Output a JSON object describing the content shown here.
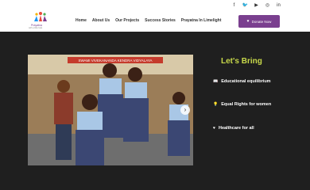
{
  "header": {
    "logo_name": "Prayatna",
    "logo_tagline": "with a little help",
    "social": [
      "facebook-icon",
      "twitter-icon",
      "youtube-icon",
      "instagram-icon",
      "linkedin-icon"
    ],
    "nav": [
      "Home",
      "About Us",
      "Our Projects",
      "Success Stories",
      "Prayatna In Limelight"
    ],
    "donate_label": "Donate Now"
  },
  "hero": {
    "school_sign": "SWAMI VIVEKANANDA KENDRA VIDYALAYA"
  },
  "mission": {
    "heading": "Let's Bring",
    "items": [
      {
        "icon": "book-icon",
        "label": "Educational equilibrium"
      },
      {
        "icon": "bulb-icon",
        "label": "Equal Rights for women"
      },
      {
        "icon": "heart-icon",
        "label": "Healthcare for all"
      }
    ]
  },
  "colors": {
    "brand": "#7a3f8f",
    "accent": "#c8d94a",
    "background": "#1f1f1f"
  }
}
